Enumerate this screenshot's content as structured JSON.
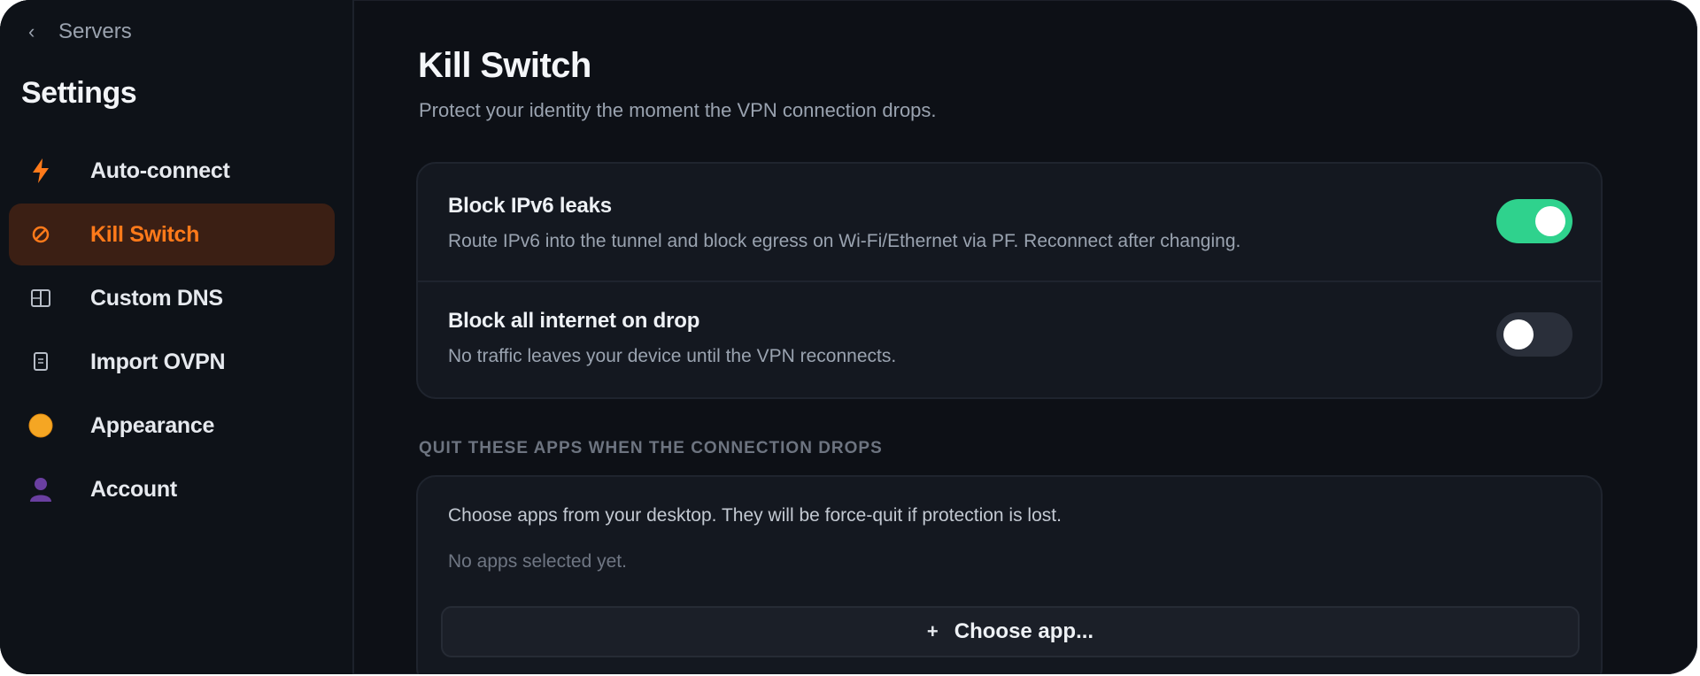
{
  "sidebar": {
    "back_label": "Servers",
    "title": "Settings",
    "items": [
      {
        "label": "Auto-connect",
        "icon": "lightning-icon",
        "active": false
      },
      {
        "label": "Kill Switch",
        "icon": "circle-slash-icon",
        "active": true
      },
      {
        "label": "Custom DNS",
        "icon": "dns-grid-icon",
        "active": false
      },
      {
        "label": "Import OVPN",
        "icon": "document-icon",
        "active": false
      },
      {
        "label": "Appearance",
        "icon": "palette-circle-icon",
        "active": false
      },
      {
        "label": "Account",
        "icon": "user-icon",
        "active": false
      }
    ]
  },
  "main": {
    "title": "Kill Switch",
    "subtitle": "Protect your identity the moment the VPN connection drops.",
    "toggles": [
      {
        "title": "Block IPv6 leaks",
        "description": "Route IPv6 into the tunnel and block egress on Wi-Fi/Ethernet via PF. Reconnect after changing.",
        "enabled": true
      },
      {
        "title": "Block all internet on drop",
        "description": "No traffic leaves your device until the VPN reconnects.",
        "enabled": false
      }
    ],
    "apps_section_label": "QUIT THESE APPS WHEN THE CONNECTION DROPS",
    "apps_help": "Choose apps from your desktop. They will be force-quit if protection is lost.",
    "apps_empty": "No apps selected yet.",
    "choose_button_icon": "+",
    "choose_button_label": "Choose app..."
  },
  "colors": {
    "accent": "#ff7a1a",
    "active_bg": "#3b1f14",
    "toggle_on": "#2fd28d",
    "background": "#0d1016",
    "card": "#141820"
  }
}
